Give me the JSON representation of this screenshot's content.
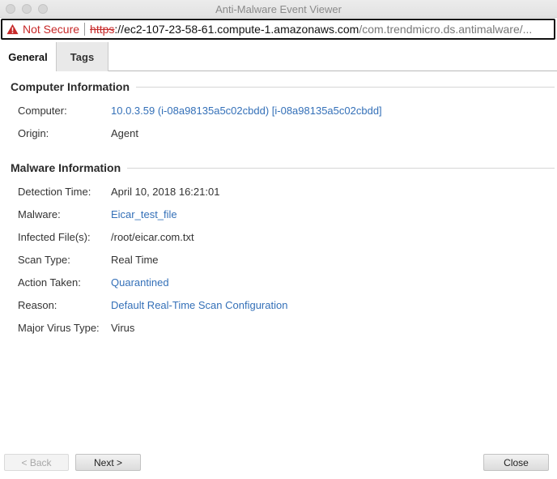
{
  "window": {
    "title": "Anti-Malware Event Viewer"
  },
  "urlbar": {
    "security_label": "Not Secure",
    "security_icon": "warning-triangle-icon",
    "scheme": "https",
    "host_rest": "://ec2-107-23-58-61.compute-1.amazonaws.com",
    "path": "/com.trendmicro.ds.antimalware/..."
  },
  "tabs": [
    {
      "label": "General",
      "selected": true
    },
    {
      "label": "Tags",
      "selected": false
    }
  ],
  "computer_info": {
    "title": "Computer Information",
    "rows": [
      {
        "label": "Computer:",
        "value": "10.0.3.59 (i-08a98135a5c02cbdd) [i-08a98135a5c02cbdd]"
      },
      {
        "label": "Origin:",
        "value": "Agent"
      }
    ]
  },
  "malware_info": {
    "title": "Malware Information",
    "rows": [
      {
        "label": "Detection Time:",
        "value": "April 10, 2018 16:21:01"
      },
      {
        "label": "Malware:",
        "value": "Eicar_test_file"
      },
      {
        "label": "Infected File(s):",
        "value": "/root/eicar.com.txt"
      },
      {
        "label": "Scan Type:",
        "value": "Real Time"
      },
      {
        "label": "Action Taken:",
        "value": "Quarantined"
      },
      {
        "label": "Reason:",
        "value": "Default Real-Time Scan Configuration"
      },
      {
        "label": "Major Virus Type:",
        "value": "Virus"
      }
    ]
  },
  "footer": {
    "back_label": "< Back",
    "next_label": "Next >",
    "close_label": "Close"
  },
  "colors": {
    "link": "#3470b8",
    "warning": "#c62828"
  }
}
